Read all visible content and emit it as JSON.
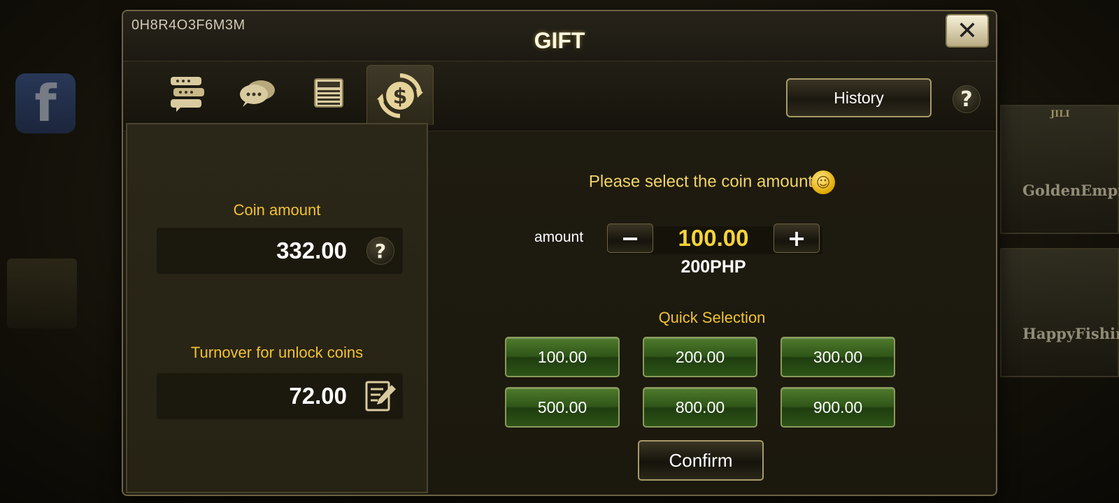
{
  "background": {
    "games": [
      {
        "label": "GoldenEmpi"
      },
      {
        "label": "HappyFishin"
      }
    ],
    "provider": "JILI"
  },
  "header": {
    "user_id": "0H8R4O3F6M3M",
    "title": "GIFT"
  },
  "tabs": [
    {
      "icon": "announcement-icon"
    },
    {
      "icon": "chat-bubbles-icon"
    },
    {
      "icon": "news-icon"
    },
    {
      "icon": "coin-transfer-icon",
      "active": true
    }
  ],
  "toolbar": {
    "history_label": "History",
    "help_label": "?"
  },
  "left_panel": {
    "coin_amount_label": "Coin amount",
    "coin_amount_value": "332.00",
    "coin_help_label": "?",
    "turnover_label": "Turnover for unlock coins",
    "turnover_value": "72.00"
  },
  "right_panel": {
    "prompt": "Please select the coin amount",
    "amount_label": "amount",
    "minus_label": "−",
    "plus_label": "+",
    "amount_value": "100.00",
    "php_value": "200PHP",
    "quick_selection_label": "Quick Selection",
    "quick_options": [
      "100.00",
      "200.00",
      "300.00",
      "500.00",
      "800.00",
      "900.00"
    ],
    "confirm_label": "Confirm"
  },
  "colors": {
    "accent_gold": "#f1c232",
    "amount_yellow": "#f6d33a",
    "quick_green": "#2f5518",
    "panel_bg": "#2b2718",
    "modal_border": "#6e6342"
  }
}
